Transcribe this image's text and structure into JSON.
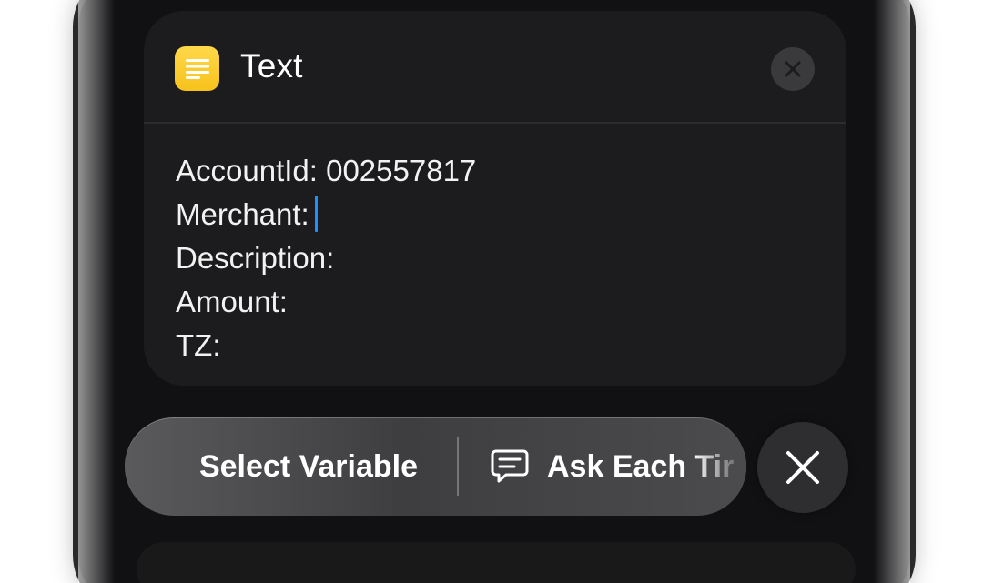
{
  "card": {
    "title": "Text",
    "app_icon": "notes-lines-icon",
    "close_icon": "close-circle-icon"
  },
  "text_content": {
    "lines": [
      "AccountId: 002557817",
      "Merchant:",
      "Description:",
      "Amount:",
      "TZ:"
    ],
    "caret_line_index": 1
  },
  "toolbar": {
    "select_variable_label": "Select Variable",
    "ask_each_time_label": "Ask Each Tir",
    "ask_icon": "speech-bubble-icon",
    "dismiss_icon": "close-icon"
  },
  "colors": {
    "accent_caret": "#1e90ff",
    "app_icon_yellow": "#f7c21b",
    "card_bg": "#1c1c1e"
  }
}
